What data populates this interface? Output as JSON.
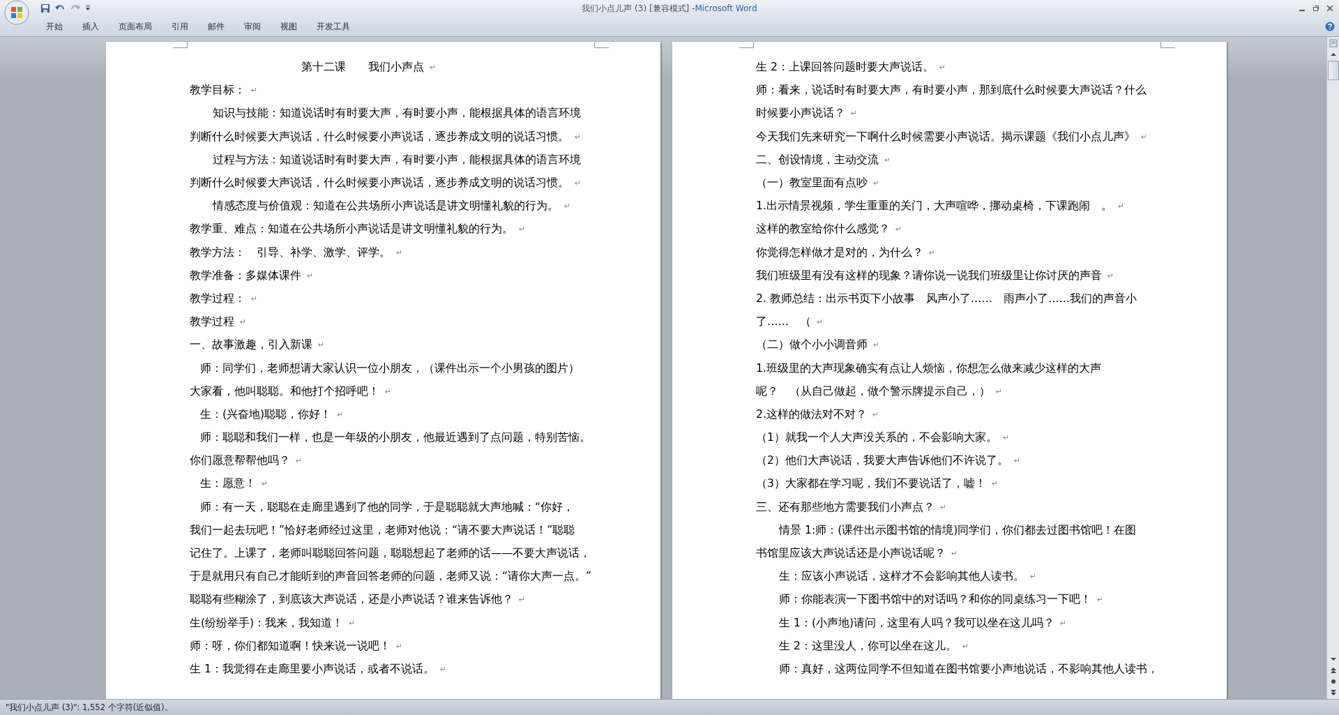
{
  "window": {
    "title": "我们小点儿声 (3) [兼容模式]",
    "separator": "-",
    "app": "Microsoft Word"
  },
  "ribbon_tabs": [
    {
      "label": "开始"
    },
    {
      "label": "插入"
    },
    {
      "label": "页面布局"
    },
    {
      "label": "引用"
    },
    {
      "label": "邮件"
    },
    {
      "label": "审阅"
    },
    {
      "label": "视图"
    },
    {
      "label": "开发工具"
    }
  ],
  "pages": [
    {
      "lines": [
        {
          "kind": "title",
          "text": "第十二课　　我们小声点",
          "end": "↵"
        },
        {
          "kind": "plain",
          "text": "教学目标：",
          "end": "↵"
        },
        {
          "kind": "para",
          "text": "知识与技能：知道说话时有时要大声，有时要小声，能根据具体的语言环境"
        },
        {
          "kind": "plain",
          "text": "判断什么时候要大声说话，什么时候要小声说话，逐步养成文明的说话习惯。",
          "end": "↵"
        },
        {
          "kind": "para",
          "text": "过程与方法：知道说话时有时要大声，有时要小声，能根据具体的语言环境"
        },
        {
          "kind": "plain",
          "text": "判断什么时候要大声说话，什么时候要小声说话，逐步养成文明的说话习惯。",
          "end": "↵"
        },
        {
          "kind": "para",
          "text": "情感态度与价值观：知道在公共场所小声说话是讲文明懂礼貌的行为。",
          "end": "↵"
        },
        {
          "kind": "plain",
          "text": "教学重、难点：知道在公共场所小声说话是讲文明懂礼貌的行为。",
          "end": "↵"
        },
        {
          "kind": "plain",
          "text": "教学方法：　引导、补学、激学、评学。",
          "end": "↵"
        },
        {
          "kind": "plain",
          "text": "教学准备：多媒体课件",
          "end": "↵"
        },
        {
          "kind": "plain",
          "text": "教学过程：",
          "end": "↵"
        },
        {
          "kind": "plain",
          "text": "教学过程",
          "end": "↵"
        },
        {
          "kind": "plain",
          "text": "一、故事激趣，引入新课",
          "end": "↵"
        },
        {
          "kind": "small",
          "text": "师：同学们，老师想请大家认识一位小朋友，（课件出示一个小男孩的图片）"
        },
        {
          "kind": "plain",
          "text": "大家看，他叫聪聪。和他打个招呼吧！",
          "end": "↵"
        },
        {
          "kind": "small",
          "text": "生：(兴奋地)聪聪，你好！",
          "end": "↵"
        },
        {
          "kind": "small",
          "text": "师：聪聪和我们一样，也是一年级的小朋友，他最近遇到了点问题，特别苦恼。"
        },
        {
          "kind": "plain",
          "text": "你们愿意帮帮他吗？",
          "end": "↵"
        },
        {
          "kind": "small",
          "text": "生：愿意！",
          "end": "↵"
        },
        {
          "kind": "small",
          "text": "师：有一天，聪聪在走廊里遇到了他的同学，于是聪聪就大声地喊：“你好，"
        },
        {
          "kind": "plain",
          "text": "我们一起去玩吧！”恰好老师经过这里，老师对他说：“请不要大声说话！”聪聪"
        },
        {
          "kind": "plain",
          "text": "记住了。上课了，老师叫聪聪回答问题，聪聪想起了老师的话——不要大声说话，"
        },
        {
          "kind": "plain",
          "text": "于是就用只有自己才能听到的声音回答老师的问题，老师又说：“请你大声一点。”"
        },
        {
          "kind": "plain",
          "text": "聪聪有些糊涂了，到底该大声说话，还是小声说话？谁来告诉他？",
          "end": "↵"
        },
        {
          "kind": "plain",
          "text": "生(纷纷举手)：我来，我知道！",
          "end": "↵"
        },
        {
          "kind": "plain",
          "text": "师：呀，你们都知道啊！快来说一说吧！",
          "end": "↵"
        },
        {
          "kind": "plain",
          "text": "生 1：我觉得在走廊里要小声说话，或者不说话。",
          "end": "↵"
        }
      ]
    },
    {
      "lines": [
        {
          "kind": "plain",
          "text": "生 2：上课回答问题时要大声说话。",
          "end": "↵"
        },
        {
          "kind": "plain",
          "text": "师：看来，说话时有时要大声，有时要小声，那到底什么时候要大声说话？什么"
        },
        {
          "kind": "plain",
          "text": "时候要小声说话？",
          "end": "↵"
        },
        {
          "kind": "plain",
          "text": "今天我们先来研究一下啊什么时候需要小声说话。揭示课题《我们小点儿声》",
          "end": "↵"
        },
        {
          "kind": "plain",
          "text": "二、创设情境，主动交流",
          "end": "↵"
        },
        {
          "kind": "plain",
          "text": "（一）教室里面有点吵",
          "end": "↵"
        },
        {
          "kind": "plain",
          "text": "1.出示情景视频，学生重重的关门，大声喧哗，挪动桌椅，下课跑闹　。",
          "end": "↵"
        },
        {
          "kind": "plain",
          "text": "这样的教室给你什么感觉？",
          "end": "↵"
        },
        {
          "kind": "plain",
          "text": "你觉得怎样做才是对的，为什么？",
          "end": "↵"
        },
        {
          "kind": "plain",
          "text": "我们班级里有没有这样的现象？请你说一说我们班级里让你讨厌的声音",
          "end": "↵"
        },
        {
          "kind": "plain",
          "text": "2. 教师总结：出示书页下小故事　风声小了……　雨声小了……我们的声音小"
        },
        {
          "kind": "plain",
          "text": "了……　（",
          "end": "↵"
        },
        {
          "kind": "plain",
          "text": "（二）做个小小调音师",
          "end": "↵"
        },
        {
          "kind": "plain",
          "text": "1.班级里的大声现象确实有点让人烦恼，你想怎么做来减少这样的大声"
        },
        {
          "kind": "plain",
          "text": "呢？　（从自己做起，做个警示牌提示自己，）",
          "end": "↵"
        },
        {
          "kind": "plain",
          "text": "2.这样的做法对不对？",
          "end": "↵"
        },
        {
          "kind": "plain",
          "text": "（1）就我一个人大声没关系的，不会影响大家。",
          "end": "↵"
        },
        {
          "kind": "plain",
          "text": "（2）他们大声说话，我要大声告诉他们不许说了。",
          "end": "↵"
        },
        {
          "kind": "plain",
          "text": "（3）大家都在学习呢，我们不要说话了，嘘！",
          "end": "↵"
        },
        {
          "kind": "plain",
          "text": "三、还有那些地方需要我们小声点？",
          "end": "↵"
        },
        {
          "kind": "para",
          "text": "情景 1:师：(课件出示图书馆的情境)同学们，你们都去过图书馆吧！在图"
        },
        {
          "kind": "plain",
          "text": "书馆里应该大声说话还是小声说话呢？",
          "end": "↵"
        },
        {
          "kind": "para",
          "text": "生：应该小声说话，这样才不会影响其他人读书。",
          "end": "↵"
        },
        {
          "kind": "para",
          "text": "师：你能表演一下图书馆中的对话吗？和你的同桌练习一下吧！",
          "end": "↵"
        },
        {
          "kind": "para",
          "text": "生 1：(小声地)请问，这里有人吗？我可以坐在这儿吗？",
          "end": "↵"
        },
        {
          "kind": "para",
          "text": "生 2：这里没人，你可以坐在这儿。",
          "end": "↵"
        },
        {
          "kind": "para",
          "text": "师：真好，这两位同学不但知道在图书馆要小声地说话，不影响其他人读书，"
        }
      ]
    }
  ],
  "status_bar": {
    "text": "\"我们小点儿声 (3)\": 1,552 个字符(近似值)。"
  }
}
